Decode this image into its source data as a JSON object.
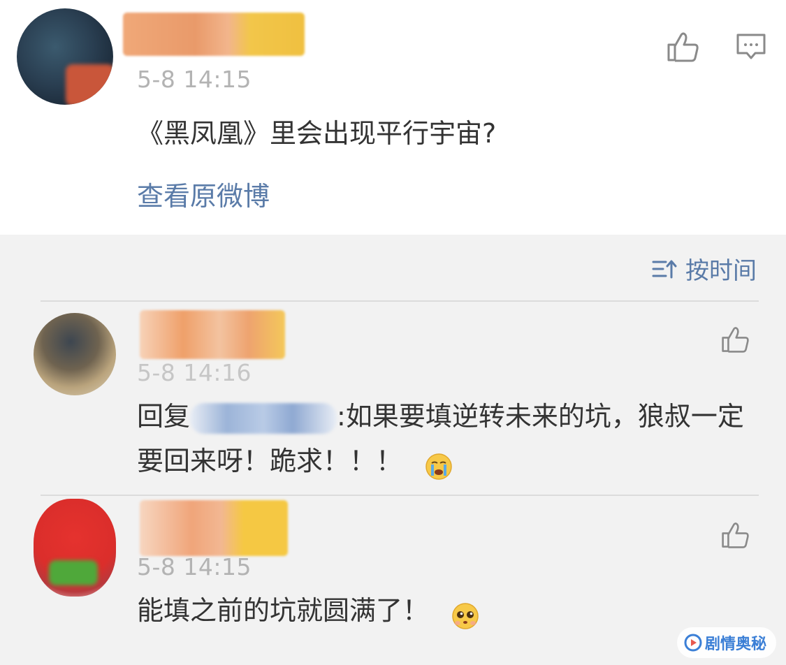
{
  "post": {
    "timestamp": "5-8 14:15",
    "text": "《黑凤凰》里会出现平行宇宙?",
    "view_original": "查看原微博"
  },
  "sort": {
    "label": "按时间"
  },
  "comments": [
    {
      "timestamp": "5-8 14:16",
      "reply_prefix": "回复",
      "text": ":如果要填逆转未来的坑，狼叔一定要回来呀！跪求！！！",
      "emoji": "crying-emoji"
    },
    {
      "timestamp": "5-8 14:15",
      "text": "能填之前的坑就圆满了！",
      "emoji": "pleading-emoji"
    }
  ],
  "watermark": {
    "text": "剧情奥秘"
  }
}
